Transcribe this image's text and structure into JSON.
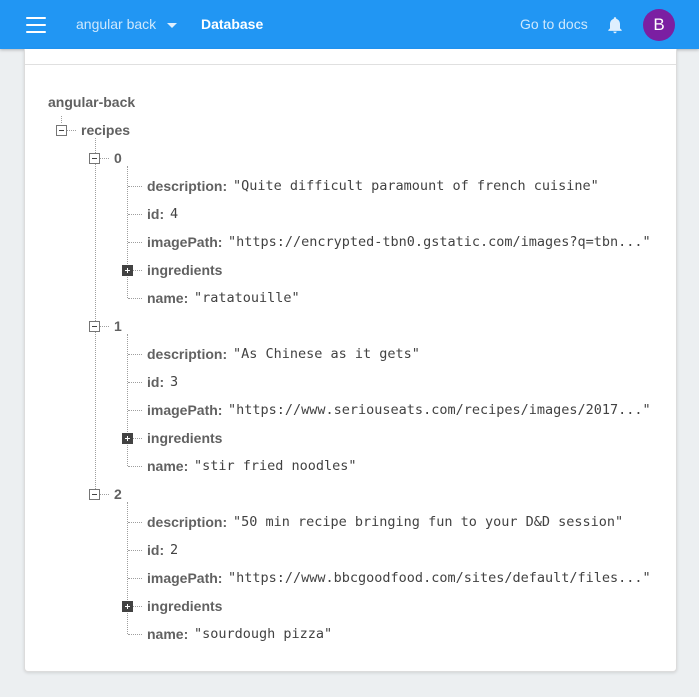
{
  "header": {
    "project": "angular back",
    "section": "Database",
    "docs_link": "Go to docs",
    "avatar_letter": "B"
  },
  "tree": {
    "root": "angular-back",
    "collection": "recipes",
    "items": [
      {
        "index": "0",
        "description_key": "description:",
        "description": "\"Quite difficult paramount of french cuisine\"",
        "id_key": "id:",
        "id": "4",
        "imagePath_key": "imagePath:",
        "imagePath": "\"https://encrypted-tbn0.gstatic.com/images?q=tbn...\"",
        "ingredients_key": "ingredients",
        "name_key": "name:",
        "name": "\"ratatouille\""
      },
      {
        "index": "1",
        "description_key": "description:",
        "description": "\"As Chinese as it gets\"",
        "id_key": "id:",
        "id": "3",
        "imagePath_key": "imagePath:",
        "imagePath": "\"https://www.seriouseats.com/recipes/images/2017...\"",
        "ingredients_key": "ingredients",
        "name_key": "name:",
        "name": "\"stir fried noodles\""
      },
      {
        "index": "2",
        "description_key": "description:",
        "description": "\"50 min recipe bringing fun to your D&D session\"",
        "id_key": "id:",
        "id": "2",
        "imagePath_key": "imagePath:",
        "imagePath": "\"https://www.bbcgoodfood.com/sites/default/files...\"",
        "ingredients_key": "ingredients",
        "name_key": "name:",
        "name": "\"sourdough pizza\""
      }
    ]
  },
  "colors": {
    "header_bg": "#2196f3",
    "avatar_bg": "#7b1fa2",
    "page_bg": "#eceff1"
  }
}
